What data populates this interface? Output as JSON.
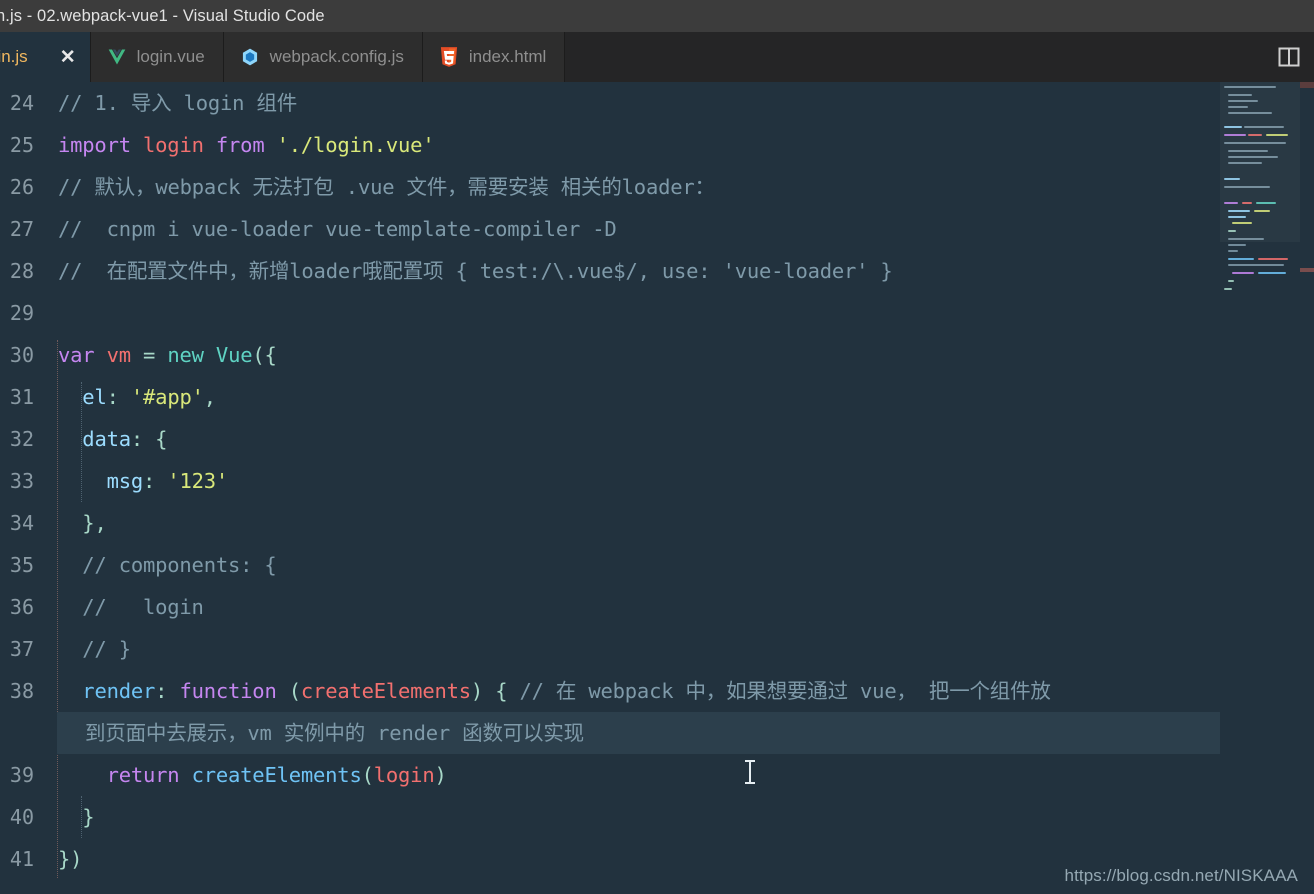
{
  "window": {
    "title": "n.js - 02.webpack-vue1 - Visual Studio Code",
    "titlebar_bg": "#3c3c3c",
    "editor_bg": "#22323e"
  },
  "tabs": {
    "items": [
      {
        "label": "ain.js",
        "icon": "js-icon",
        "active": true,
        "has_close": true,
        "close_glyph": "✕"
      },
      {
        "label": "login.vue",
        "icon": "vue-icon",
        "active": false,
        "has_close": false
      },
      {
        "label": "webpack.config.js",
        "icon": "webpack-icon",
        "active": false,
        "has_close": false
      },
      {
        "label": "index.html",
        "icon": "html5-icon",
        "active": false,
        "has_close": false
      }
    ],
    "actions": [
      {
        "name": "split-editor-icon",
        "label": "Split Editor"
      }
    ]
  },
  "editor": {
    "first_line_number": 24,
    "line_numbers": [
      24,
      25,
      26,
      27,
      28,
      29,
      30,
      31,
      32,
      33,
      34,
      35,
      36,
      37,
      38,
      39,
      40,
      41
    ],
    "lines": [
      {
        "n": 24,
        "text": "// 1. 导入 login 组件"
      },
      {
        "n": 25,
        "text": "import login from './login.vue'"
      },
      {
        "n": 26,
        "text": "// 默认，webpack 无法打包 .vue 文件，需要安装 相关的loader："
      },
      {
        "n": 27,
        "text": "//  cnpm i vue-loader vue-template-compiler -D"
      },
      {
        "n": 28,
        "text": "//  在配置文件中，新增loader哦配置项 { test:/\\.vue$/, use: 'vue-loader' }"
      },
      {
        "n": 29,
        "text": ""
      },
      {
        "n": 30,
        "text": "var vm = new Vue({"
      },
      {
        "n": 31,
        "text": "  el: '#app',"
      },
      {
        "n": 32,
        "text": "  data: {"
      },
      {
        "n": 33,
        "text": "    msg: '123'"
      },
      {
        "n": 34,
        "text": "  },"
      },
      {
        "n": 35,
        "text": "  // components: {"
      },
      {
        "n": 36,
        "text": "  //   login"
      },
      {
        "n": 37,
        "text": "  // }"
      },
      {
        "n": 38,
        "text": "  render: function (createElements) { // 在 webpack 中，如果想要通过 vue， 把一个组件放到页面中去展示，vm 实例中的 render 函数可以实现"
      },
      {
        "n": 39,
        "text": "    return createElements(login)"
      },
      {
        "n": 40,
        "text": "  }"
      },
      {
        "n": 41,
        "text": "})"
      }
    ],
    "wrapped_continuation": "到页面中去展示，vm 实例中的 render 函数可以实现",
    "highlighted_line": 38,
    "colors": {
      "comment": "#7f9aa9",
      "keyword": "#c586f0",
      "variable": "#f2706f",
      "string": "#d9e87a",
      "property": "#9cdcfe",
      "function": "#6fc3f5",
      "punctuation": "#a8d8c8",
      "selection_bg": "#2c3f4c"
    }
  },
  "watermark": {
    "text": "https://blog.csdn.net/NISKAAA"
  }
}
